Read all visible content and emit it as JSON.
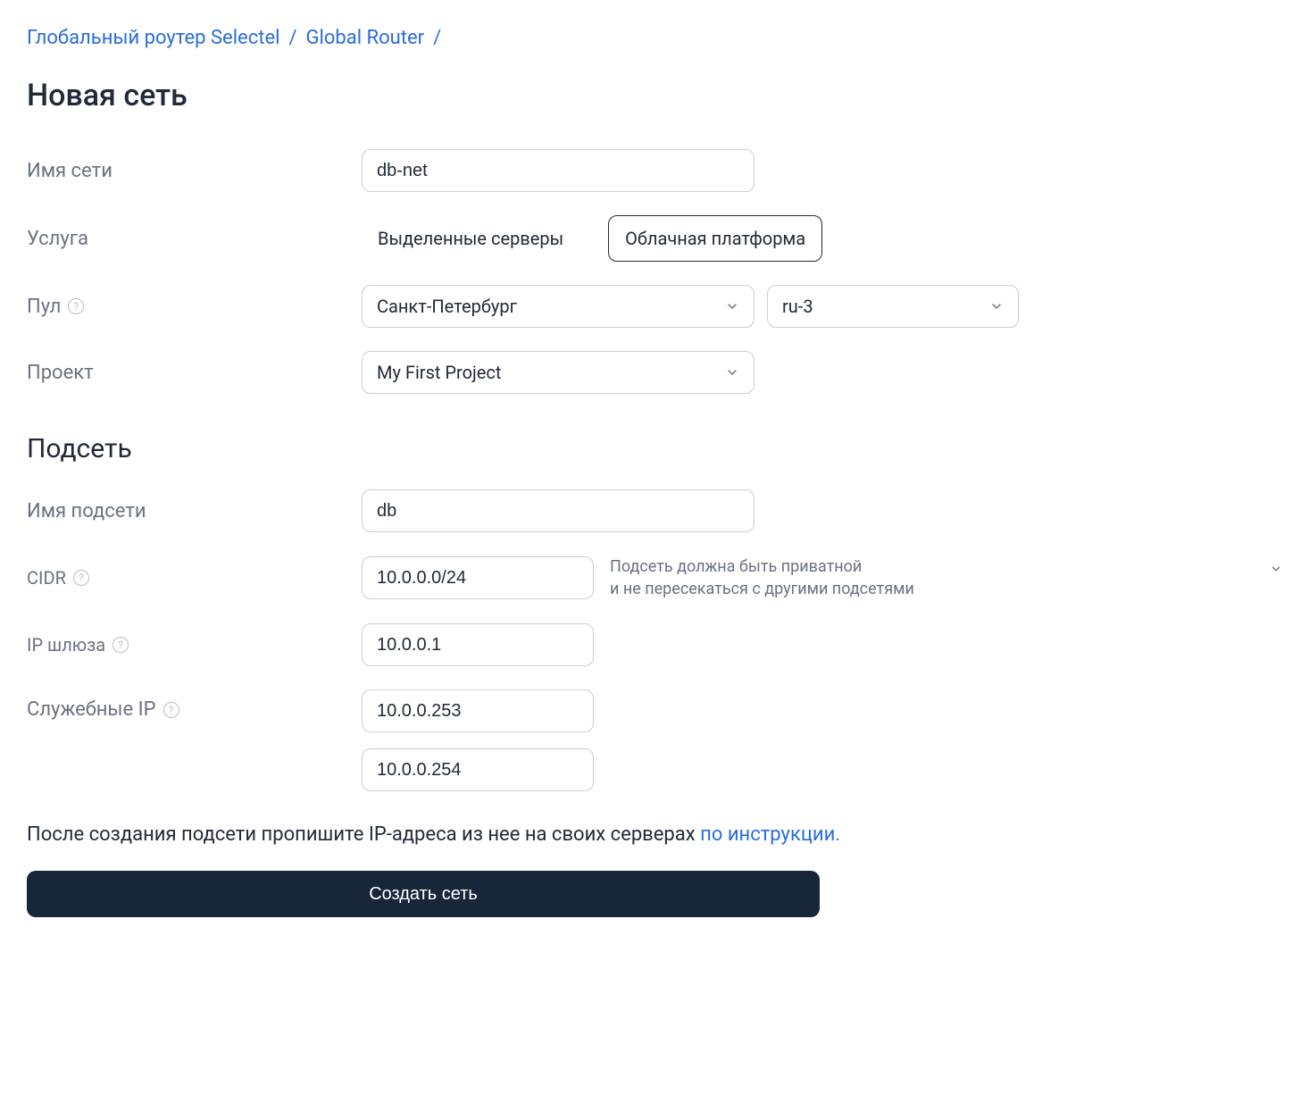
{
  "breadcrumb": {
    "item1": "Глобальный роутер Selectel",
    "item2": "Global Router",
    "sep": "/"
  },
  "title": "Новая сеть",
  "form": {
    "network_name": {
      "label": "Имя сети",
      "value": "db-net"
    },
    "service": {
      "label": "Услуга",
      "option_dedicated": "Выделенные серверы",
      "option_cloud": "Облачная платформа"
    },
    "pool": {
      "label": "Пул",
      "city": "Санкт-Петербург",
      "region": "ru-3"
    },
    "project": {
      "label": "Проект",
      "value": "My First Project"
    }
  },
  "subnet": {
    "title": "Подсеть",
    "name": {
      "label": "Имя подсети",
      "value": "db"
    },
    "cidr": {
      "label": "CIDR",
      "value": "10.0.0.0/24",
      "note_line1": "Подсеть должна быть приватной",
      "note_line2": "и не пересекаться с другими подсетями"
    },
    "gateway": {
      "label": "IP шлюза",
      "value": "10.0.0.1"
    },
    "service_ips": {
      "label": "Служебные IP",
      "ip1": "10.0.0.253",
      "ip2": "10.0.0.254"
    }
  },
  "info": {
    "text": "После создания подсети пропишите IP-адреса из нее на своих серверах ",
    "link": "по инструкции."
  },
  "submit": "Создать сеть"
}
